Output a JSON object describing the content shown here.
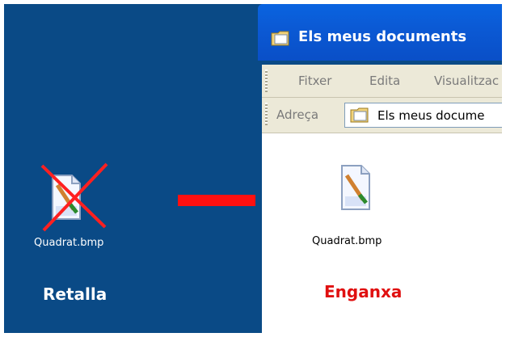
{
  "desktop": {
    "file_name": "Quadrat.bmp",
    "caption": "Retalla"
  },
  "window": {
    "title": "Els meus documents",
    "menu": [
      "Fitxer",
      "Edita",
      "Visualitzac"
    ],
    "address_label": "Adreça",
    "address_value": "Els meus docume",
    "file_name": "Quadrat.bmp",
    "caption": "Enganxa"
  },
  "icons": [
    "bitmap-file-icon",
    "red-cross-icon",
    "red-arrow-icon",
    "folder-icon"
  ],
  "colors": {
    "desktop_bg": "#0a4a86",
    "title_bar": "#0b5ad5",
    "cut_caption": "#ffffff",
    "paste_caption": "#e01010",
    "arrow": "#e01010"
  }
}
